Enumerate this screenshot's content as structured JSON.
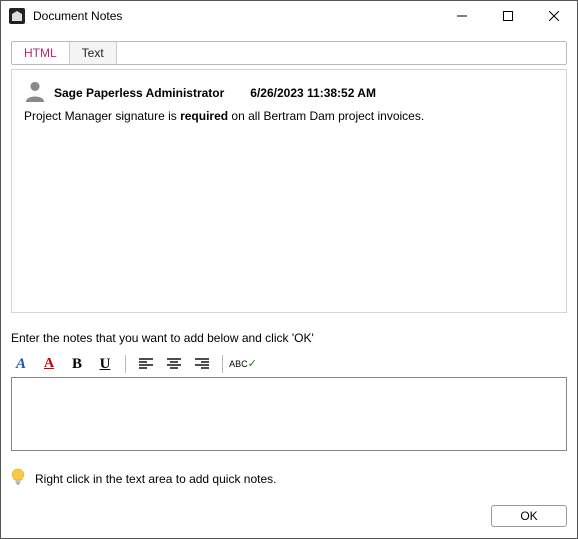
{
  "window": {
    "title": "Document Notes"
  },
  "tabs": {
    "html": "HTML",
    "text": "Text"
  },
  "note": {
    "author": "Sage Paperless Administrator",
    "timestamp": "6/26/2023 11:38:52 AM",
    "body_prefix": "Project Manager signature is ",
    "body_bold": "required",
    "body_suffix": " on all Bertram Dam project invoices."
  },
  "instruction": "Enter the notes that you want to add below and click 'OK'",
  "toolbar": {
    "font_style_label": "A",
    "font_color_label": "A",
    "bold_label": "B",
    "underline_label": "U",
    "spell_abc": "ABC"
  },
  "input": {
    "value": ""
  },
  "tip": "Right click in the text area to add quick notes.",
  "footer": {
    "ok": "OK"
  }
}
